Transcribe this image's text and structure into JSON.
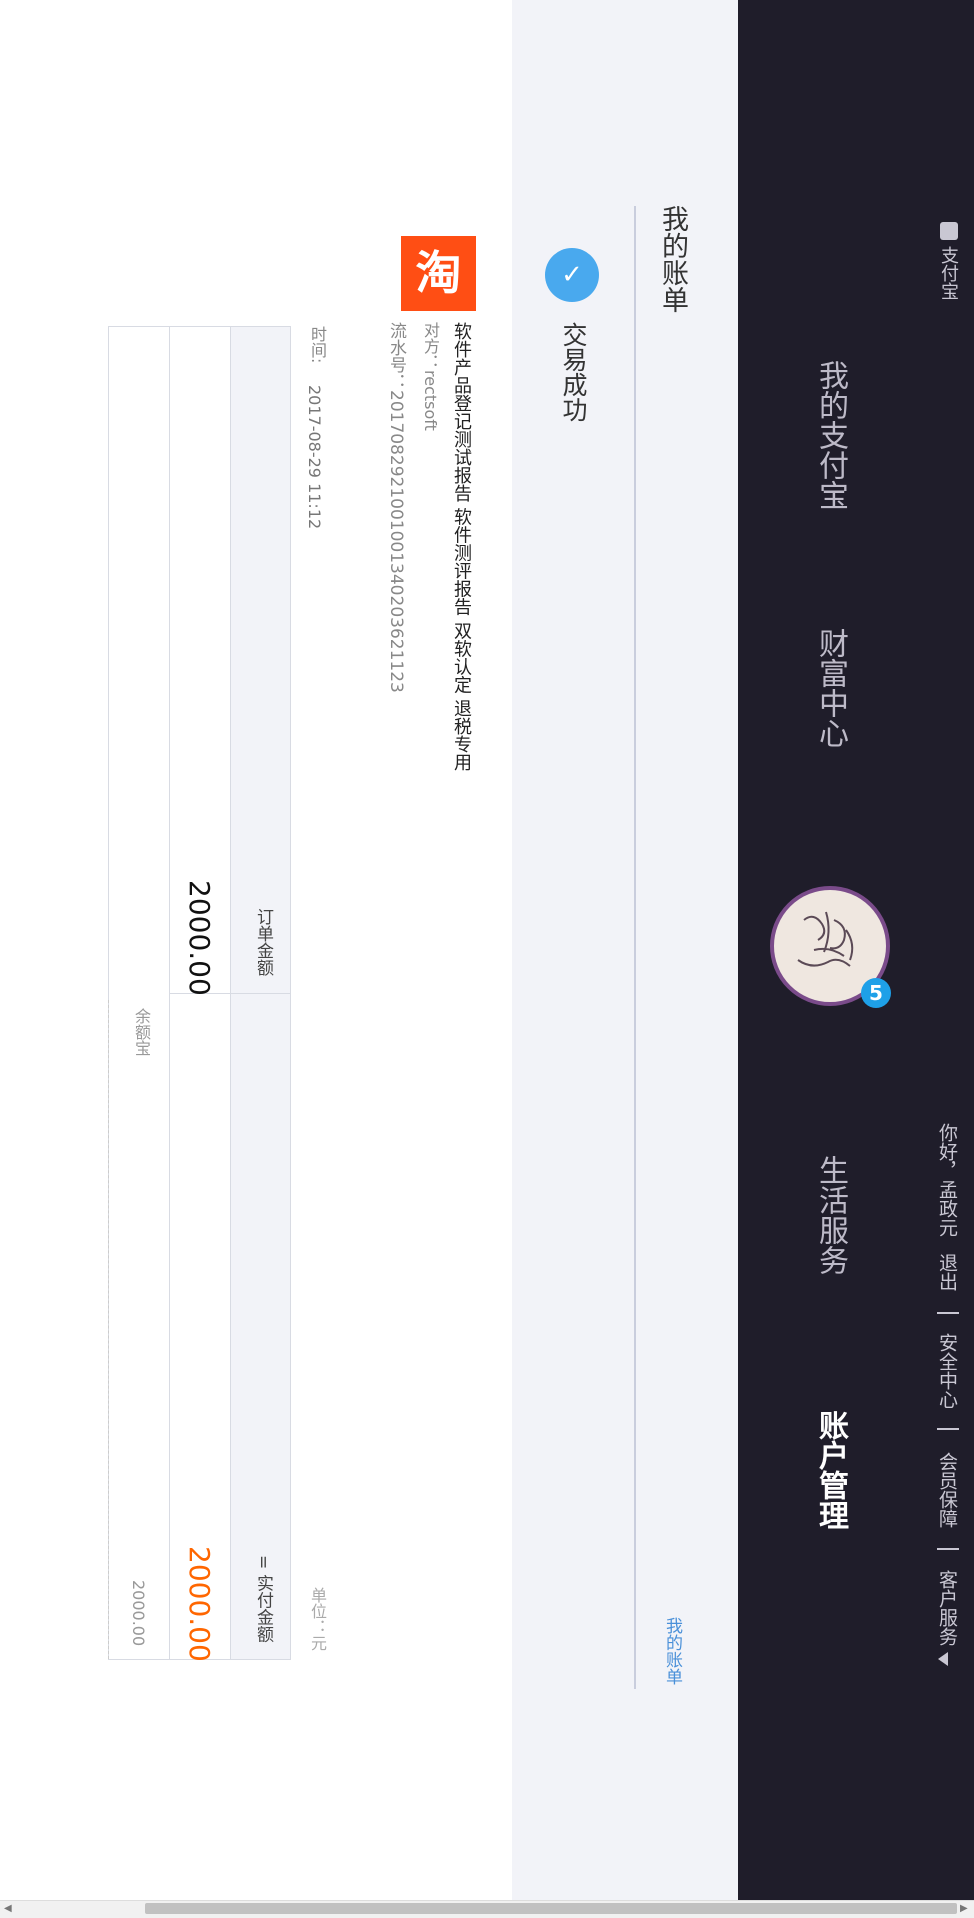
{
  "topbar": {
    "brand": "支付宝",
    "greeting": "你好，孟政元",
    "logout": "退出",
    "links": [
      "安全中心",
      "会员保障",
      "客户服务"
    ],
    "dropdown_icon": "caret-down"
  },
  "nav": {
    "items": [
      "我的支付宝",
      "财富中心",
      "生活服务",
      "账户管理"
    ],
    "active": "账户管理",
    "avatar_badge": "5"
  },
  "page": {
    "title": "我的账单",
    "breadcrumb": "我的账单"
  },
  "bill": {
    "status": "交易成功",
    "logo_text": "淘",
    "product_name": "软件产品登记测试报告 软件测评报告 双软认定 退税专用",
    "counterparty": "对方：rectsoft",
    "serial": "流水号：20170829210010013402036​21123",
    "time_label": "时间:",
    "time_value": "2017-08-29 11:12",
    "unit": "单位：元"
  },
  "table": {
    "order_header": "订单金额",
    "order_amount": "2000.00",
    "paid_header": "= 实付金额",
    "paid_amount": "2000.00",
    "method": "余额宝",
    "method_amount": "2000.00"
  },
  "colors": {
    "dark_bg": "#1f1d2a",
    "accent_blue": "#49a9ee",
    "paid_orange": "#ff6600",
    "taobao_orange": "#ff4e14"
  }
}
